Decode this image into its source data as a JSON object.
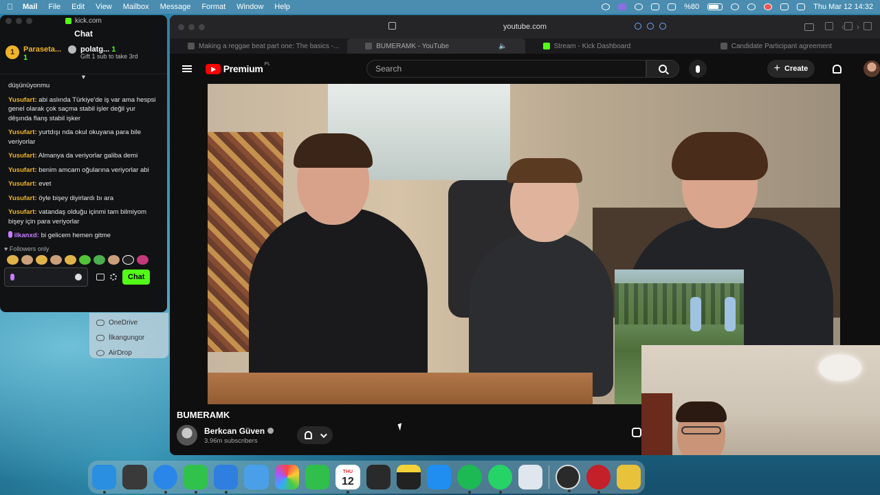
{
  "menubar": {
    "app": "Mail",
    "items": [
      "File",
      "Edit",
      "View",
      "Mailbox",
      "Message",
      "Format",
      "Window",
      "Help"
    ],
    "battery": "%80",
    "clock": "Thu Mar 12  14:32"
  },
  "kick": {
    "url": "kick.com",
    "title": "Chat",
    "leaders": [
      {
        "rank": "1",
        "name": "Paraseta...",
        "count": "1"
      },
      {
        "name": "polatg...",
        "count": "1",
        "note": "Gift 1 sub to take 3rd"
      }
    ],
    "messages": [
      {
        "user": "",
        "text": "düşünüyonmu"
      },
      {
        "user": "Yusufart:",
        "text": "abi aslında Türkiye'de iş var ama hespsi genel olarak çok saçma stabil işler değil yur dêşında flanş stabil işker"
      },
      {
        "user": "Yusufart:",
        "text": "yurtdışı nda okul okuyana para bile veriyorlar"
      },
      {
        "user": "Yusufart:",
        "text": "Almanya da veriyorlar galiba demi"
      },
      {
        "user": "Yusufart:",
        "text": "benim amcam oğularına veriyorlar abi"
      },
      {
        "user": "Yusufart:",
        "text": "evet"
      },
      {
        "user": "Yusufart:",
        "text": "öyle bişey diyirlardı bı ara"
      },
      {
        "user": "Yusufart:",
        "text": "vatandaş olduğu içinmi tam bilmiyom bişey için para veriyorlar"
      },
      {
        "user": "ilkanxd:",
        "text": "bi gelicem hemen gitme",
        "alt": true
      }
    ],
    "followers_only": "Followers only",
    "chat_button": "Chat"
  },
  "finder": {
    "items": [
      "OneDrive",
      "İlkangungor",
      "AirDrop"
    ]
  },
  "browser": {
    "url": "youtube.com",
    "tabs": [
      {
        "label": "Making a reggae beat part one: The basics -...",
        "active": false
      },
      {
        "label": "BUMERAMK - YouTube",
        "active": true
      },
      {
        "label": "Stream - Kick Dashboard",
        "active": false
      },
      {
        "label": "Candidate Participant agreement",
        "active": false
      }
    ]
  },
  "youtube": {
    "brand": "Premium",
    "region": "PL",
    "search_placeholder": "Search",
    "create_label": "Create",
    "video_title": "BUMERAMK",
    "channel_name": "Berkcan Güven",
    "subscribers": "3.96m subscribers"
  },
  "dock": {
    "calendar_day": "12",
    "calendar_month": "THU",
    "apps": [
      {
        "name": "finder",
        "color": "#2a8fe0"
      },
      {
        "name": "launchpad",
        "color": "#3a3a3a"
      },
      {
        "name": "safari",
        "color": "#2a86e8"
      },
      {
        "name": "messages",
        "color": "#30c24a"
      },
      {
        "name": "mail",
        "color": "#2f7fe0"
      },
      {
        "name": "app-store-beta",
        "color": "#4aa0e8"
      },
      {
        "name": "photos",
        "color": "#f0f0f0"
      },
      {
        "name": "facetime",
        "color": "#2fbf4a"
      },
      {
        "name": "calendar",
        "color": "#ffffff"
      },
      {
        "name": "reminders",
        "color": "#2a2a2a"
      },
      {
        "name": "notes",
        "color": "#f5d23a"
      },
      {
        "name": "xcode-app-store",
        "color": "#1f8ef0"
      },
      {
        "name": "spotify",
        "color": "#1db954"
      },
      {
        "name": "whatsapp",
        "color": "#25d366"
      },
      {
        "name": "preview",
        "color": "#dfe6ee"
      },
      {
        "name": "obs",
        "color": "#2a2a2a"
      },
      {
        "name": "vpn",
        "color": "#c3202a"
      },
      {
        "name": "misc",
        "color": "#e8c23a"
      }
    ]
  }
}
